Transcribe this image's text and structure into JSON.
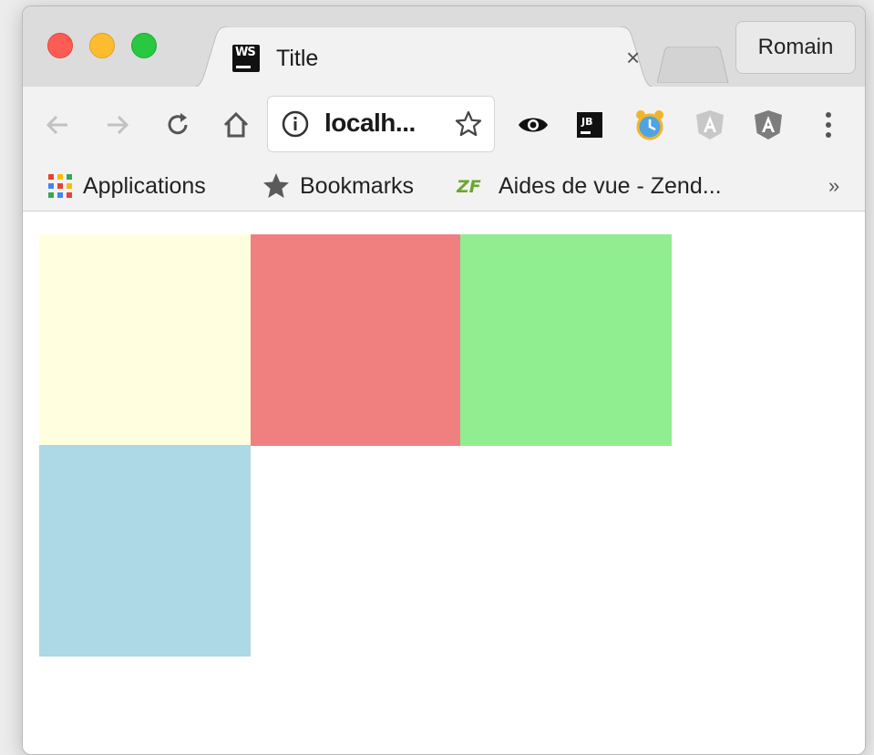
{
  "window": {
    "tab": {
      "title": "Title",
      "favicon": "WS",
      "close": "×"
    },
    "profile": "Romain"
  },
  "toolbar": {
    "back_icon": "arrow-left-icon",
    "forward_icon": "arrow-right-icon",
    "reload_icon": "reload-icon",
    "home_icon": "home-icon",
    "url": "localh...",
    "menu_icon": "more-vert-icon"
  },
  "bookmarks": {
    "items": [
      {
        "label": "Applications",
        "icon": "apps-grid-icon"
      },
      {
        "label": "Bookmarks",
        "icon": "star-icon"
      },
      {
        "label": "Aides de vue - Zend...",
        "icon": "zf-icon"
      }
    ],
    "more": "»"
  },
  "content": {
    "boxes": [
      {
        "color": "#ffffe0"
      },
      {
        "color": "#f08080"
      },
      {
        "color": "#90ee90"
      },
      {
        "color": "#add8e6"
      }
    ]
  }
}
